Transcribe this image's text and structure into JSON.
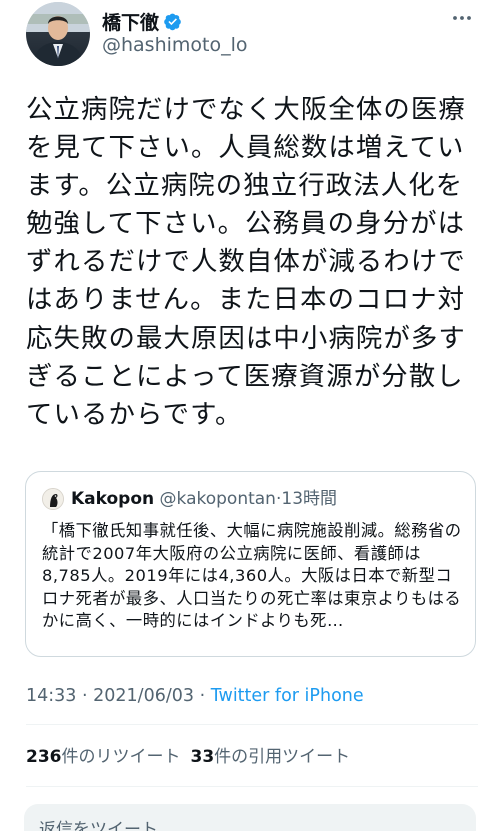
{
  "author": {
    "display_name": "橋下徹",
    "handle": "@hashimoto_lo",
    "verified": true
  },
  "tweet": {
    "text": "公立病院だけでなく大阪全体の医療を見て下さい。人員総数は増えています。公立病院の独立行政法人化を勉強して下さい。公務員の身分がはずれるだけで人数自体が減るわけではありません。また日本のコロナ対応失敗の最大原因は中小病院が多すぎることによって医療資源が分散しているからです。"
  },
  "quoted_tweet": {
    "display_name": "Kakopon",
    "handle": "@kakopontan",
    "separator": "·",
    "time": "13時間",
    "text": "「橋下徹氏知事就任後、大幅に病院施設削減。総務省の統計で2007年大阪府の公立病院に医師、看護師は8,785人。2019年には4,360人。大阪は日本で新型コロナ死者が最多、人口当たりの死亡率は東京よりもはるかに高く、一時的にはインドよりも死…"
  },
  "timestamp": {
    "time": "14:33",
    "separator1": " · ",
    "date": "2021/06/03",
    "separator2": " · ",
    "source": "Twitter for iPhone"
  },
  "stats": {
    "retweets_count": "236",
    "retweets_label": "件のリツイート",
    "quotes_count": "33",
    "quotes_label": "件の引用ツイート"
  },
  "reply": {
    "placeholder": "返信をツイート"
  },
  "icons": {
    "verified": "verified-badge-icon",
    "more": "more-dots-icon"
  },
  "colors": {
    "accent": "#1d9bf0",
    "text": "#0f1419",
    "secondary": "#536471",
    "border": "#cfd9de"
  }
}
